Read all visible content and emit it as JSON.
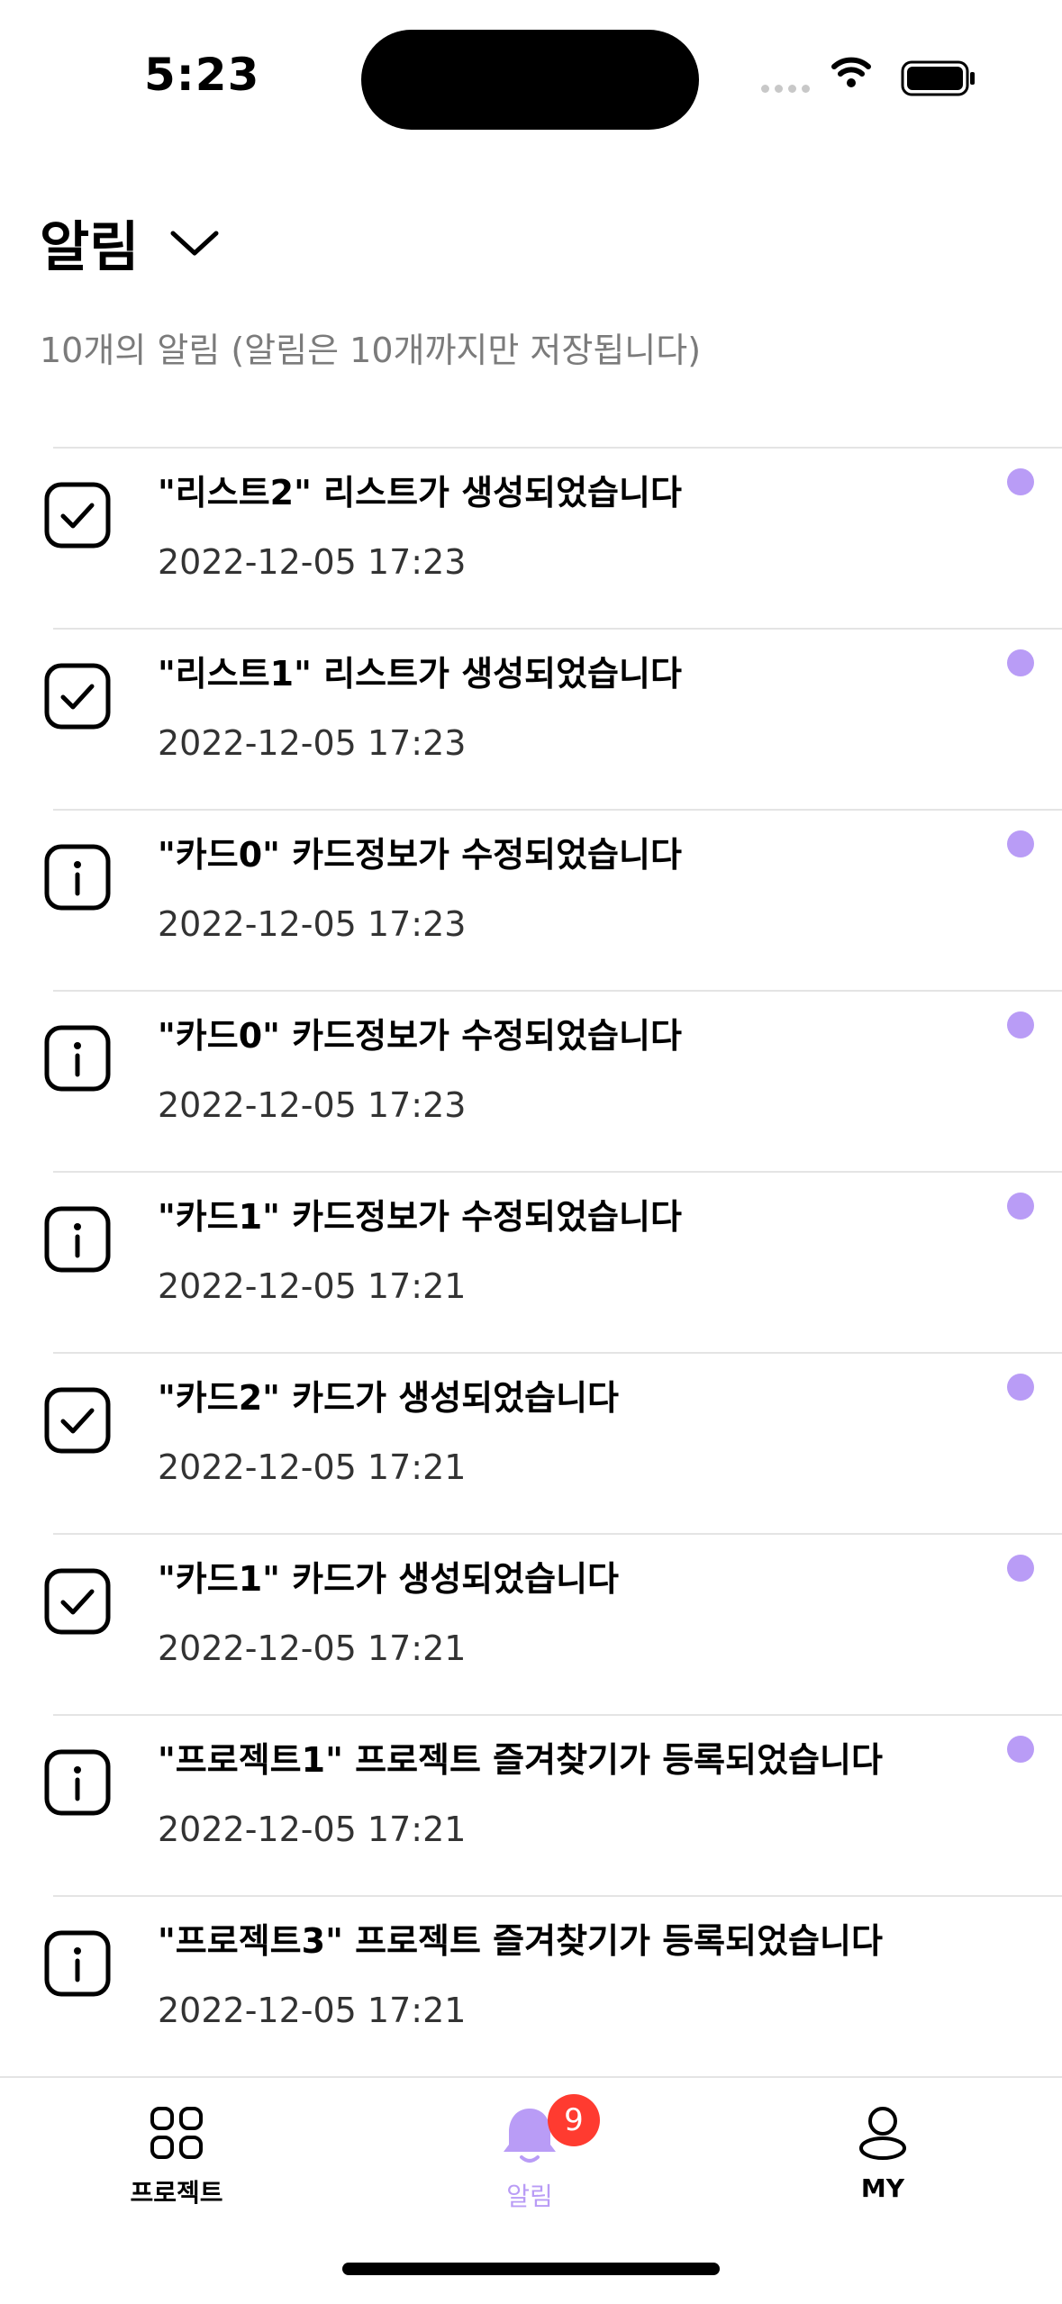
{
  "status_bar": {
    "time": "5:23"
  },
  "header": {
    "title": "알림",
    "subtitle": "10개의 알림 (알림은 10개까지만 저장됩니다)"
  },
  "notifications": [
    {
      "icon": "check-icon",
      "title": "\"리스트2\" 리스트가 생성되었습니다",
      "time": "2022-12-05 17:23",
      "unread": true
    },
    {
      "icon": "check-icon",
      "title": "\"리스트1\" 리스트가 생성되었습니다",
      "time": "2022-12-05 17:23",
      "unread": true
    },
    {
      "icon": "info-icon",
      "title": "\"카드0\" 카드정보가 수정되었습니다",
      "time": "2022-12-05 17:23",
      "unread": true
    },
    {
      "icon": "info-icon",
      "title": "\"카드0\" 카드정보가 수정되었습니다",
      "time": "2022-12-05 17:23",
      "unread": true
    },
    {
      "icon": "info-icon",
      "title": "\"카드1\" 카드정보가 수정되었습니다",
      "time": "2022-12-05 17:21",
      "unread": true
    },
    {
      "icon": "check-icon",
      "title": "\"카드2\" 카드가 생성되었습니다",
      "time": "2022-12-05 17:21",
      "unread": true
    },
    {
      "icon": "check-icon",
      "title": "\"카드1\" 카드가 생성되었습니다",
      "time": "2022-12-05 17:21",
      "unread": true
    },
    {
      "icon": "info-icon",
      "title": "\"프로젝트1\" 프로젝트 즐겨찾기가 등록되었습니다",
      "time": "2022-12-05 17:21",
      "unread": true
    },
    {
      "icon": "info-icon",
      "title": "\"프로젝트3\" 프로젝트 즐겨찾기가 등록되었습니다",
      "time": "2022-12-05 17:21",
      "unread": false
    }
  ],
  "tab_bar": {
    "projects_label": "프로젝트",
    "alerts_label": "알림",
    "alerts_badge": "9",
    "my_label": "MY"
  },
  "colors": {
    "accent": "#b99cf6",
    "badge": "#ff3b30",
    "divider": "#e4e4e4"
  }
}
